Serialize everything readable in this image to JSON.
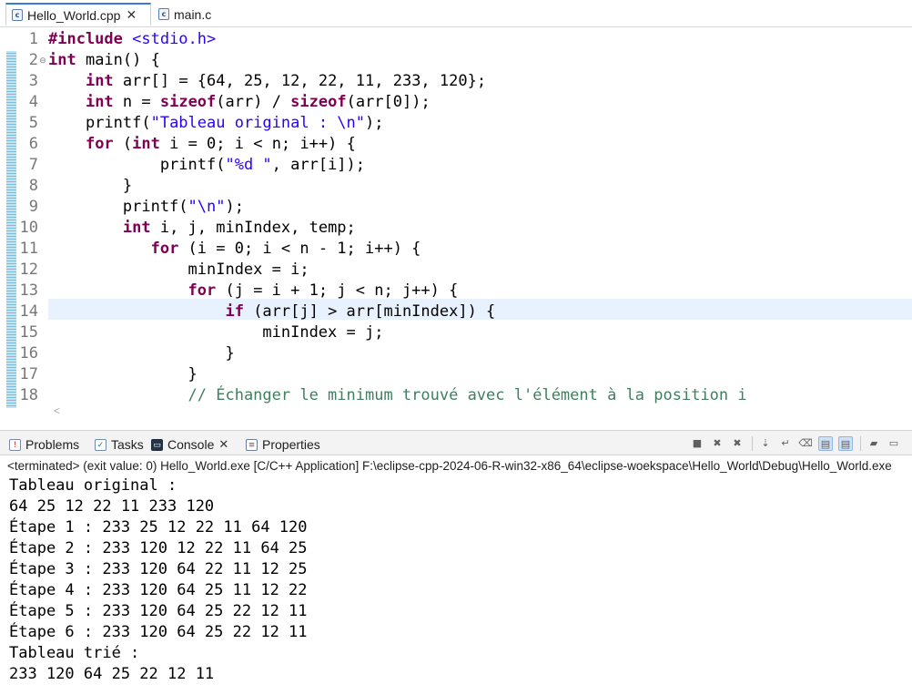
{
  "editor_tabs": [
    {
      "label": "Hello_World.cpp",
      "icon": "c-file-icon",
      "active": true
    },
    {
      "label": "main.c",
      "icon": "c-file-icon",
      "active": false
    }
  ],
  "editor": {
    "line_numbers": [
      "1",
      "2",
      "3",
      "4",
      "5",
      "6",
      "7",
      "8",
      "9",
      "10",
      "11",
      "12",
      "13",
      "14",
      "15",
      "16",
      "17",
      "18"
    ],
    "current_line": "14",
    "highlight_color": "#e8f2fe",
    "colors": {
      "keyword": "#7f0055",
      "string": "#2a00ff",
      "comment": "#3f7f5f"
    },
    "lines": [
      {
        "segments": [
          {
            "t": "#include ",
            "k": "kw"
          },
          {
            "t": "<stdio.h>",
            "k": "str"
          }
        ]
      },
      {
        "segments": [
          {
            "t": "int",
            "k": "kw"
          },
          {
            "t": " main() {",
            "k": ""
          }
        ]
      },
      {
        "segments": [
          {
            "t": "    ",
            "k": ""
          },
          {
            "t": "int",
            "k": "kw"
          },
          {
            "t": " arr[] = {64, 25, 12, 22, 11, 233, 120};",
            "k": ""
          }
        ]
      },
      {
        "segments": [
          {
            "t": "    ",
            "k": ""
          },
          {
            "t": "int",
            "k": "kw"
          },
          {
            "t": " n = ",
            "k": ""
          },
          {
            "t": "sizeof",
            "k": "kw"
          },
          {
            "t": "(arr) / ",
            "k": ""
          },
          {
            "t": "sizeof",
            "k": "kw"
          },
          {
            "t": "(arr[0]);",
            "k": ""
          }
        ]
      },
      {
        "segments": [
          {
            "t": "    printf(",
            "k": ""
          },
          {
            "t": "\"Tableau original : \\n\"",
            "k": "str"
          },
          {
            "t": ");",
            "k": ""
          }
        ]
      },
      {
        "segments": [
          {
            "t": "    ",
            "k": ""
          },
          {
            "t": "for",
            "k": "kw"
          },
          {
            "t": " (",
            "k": ""
          },
          {
            "t": "int",
            "k": "kw"
          },
          {
            "t": " i = 0; i < n; i++) {",
            "k": ""
          }
        ]
      },
      {
        "segments": [
          {
            "t": "            printf(",
            "k": ""
          },
          {
            "t": "\"%d \"",
            "k": "str"
          },
          {
            "t": ", arr[i]);",
            "k": ""
          }
        ]
      },
      {
        "segments": [
          {
            "t": "        }",
            "k": ""
          }
        ]
      },
      {
        "segments": [
          {
            "t": "        printf(",
            "k": ""
          },
          {
            "t": "\"\\n\"",
            "k": "str"
          },
          {
            "t": ");",
            "k": ""
          }
        ]
      },
      {
        "segments": [
          {
            "t": "        ",
            "k": ""
          },
          {
            "t": "int",
            "k": "kw"
          },
          {
            "t": " i, j, minIndex, temp;",
            "k": ""
          }
        ]
      },
      {
        "segments": [
          {
            "t": "           ",
            "k": ""
          },
          {
            "t": "for",
            "k": "kw"
          },
          {
            "t": " (i = 0; i < n - 1; i++) {",
            "k": ""
          }
        ]
      },
      {
        "segments": [
          {
            "t": "               minIndex = i;",
            "k": ""
          }
        ]
      },
      {
        "segments": [
          {
            "t": "               ",
            "k": ""
          },
          {
            "t": "for",
            "k": "kw"
          },
          {
            "t": " (j = i + 1; j < n; j++) {",
            "k": ""
          }
        ]
      },
      {
        "segments": [
          {
            "t": "                   ",
            "k": ""
          },
          {
            "t": "if",
            "k": "kw"
          },
          {
            "t": " (arr[j] > arr[minIndex]) {",
            "k": ""
          }
        ]
      },
      {
        "segments": [
          {
            "t": "                       minIndex = j;",
            "k": ""
          }
        ]
      },
      {
        "segments": [
          {
            "t": "                   }",
            "k": ""
          }
        ]
      },
      {
        "segments": [
          {
            "t": "               }",
            "k": ""
          }
        ]
      },
      {
        "segments": [
          {
            "t": "               ",
            "k": ""
          },
          {
            "t": "// Échanger le minimum trouvé avec l'élément à la position i",
            "k": "cmt"
          }
        ]
      }
    ]
  },
  "console_view": {
    "tabs": [
      {
        "label": "Problems",
        "icon": "problems-icon"
      },
      {
        "label": "Tasks",
        "icon": "tasks-icon"
      },
      {
        "label": "Console",
        "icon": "console-icon",
        "active": true
      },
      {
        "label": "Properties",
        "icon": "properties-icon"
      }
    ],
    "toolbar_icons": [
      "terminate-icon",
      "remove-launch-icon",
      "remove-all-terminated-icon",
      "scroll-lock-icon",
      "word-wrap-icon",
      "clear-console-icon",
      "show-console-on-output-icon",
      "show-console-on-error-icon",
      "pin-console-icon",
      "display-selected-console-icon"
    ],
    "header": "<terminated> (exit value: 0) Hello_World.exe [C/C++ Application] F:\\eclipse-cpp-2024-06-R-win32-x86_64\\eclipse-woekspace\\Hello_World\\Debug\\Hello_World.exe",
    "output_lines": [
      "Tableau original :",
      "64 25 12 22 11 233 120",
      "Étape 1 : 233 25 12 22 11 64 120",
      "Étape 2 : 233 120 12 22 11 64 25",
      "Étape 3 : 233 120 64 22 11 12 25",
      "Étape 4 : 233 120 64 25 11 12 22",
      "Étape 5 : 233 120 64 25 22 12 11",
      "Étape 6 : 233 120 64 25 22 12 11",
      "Tableau trié :",
      "233 120 64 25 22 12 11"
    ]
  }
}
